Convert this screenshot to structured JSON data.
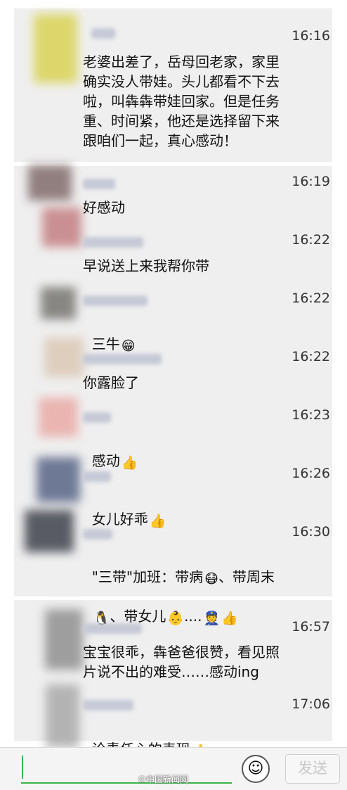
{
  "messages": [
    {
      "time": "16:16",
      "text": "老婆出差了，岳母回老家，家里\n确实没人带娃。头儿都看不下去\n啦，叫犇犇带娃回家。但是任务\n重、时间紧，他还是选择留下来\n跟咱们一起，真心感动！"
    },
    {
      "time": "16:19",
      "text": "好感动"
    },
    {
      "time": "16:22",
      "text": "早说送上来我帮你带"
    },
    {
      "time": "16:22",
      "text": "三牛",
      "emoji": "😁"
    },
    {
      "time": "16:22",
      "text": "你露脸了"
    },
    {
      "time": "16:23",
      "text": "感动",
      "emoji": "👍"
    },
    {
      "time": "16:26",
      "text": "女儿好乖",
      "emoji": "👍"
    },
    {
      "time": "16:30",
      "text_line1": "\"三带\"加班：带病",
      "emoji1": "😷",
      "text_line1b": "、带周末",
      "emoji2": "🐧",
      "text_line2": "、带女儿",
      "emoji3": "👶",
      "text_line2b": "....",
      "emoji4": "👮",
      "emoji5": "👍"
    },
    {
      "time": "16:57",
      "text": "宝宝很乖，犇爸爸很赞，看见照\n片说不出的难受……感动ing"
    },
    {
      "time": "17:06",
      "text": "论责任心的表现",
      "emoji": "👍"
    }
  ],
  "composer": {
    "emoji_icon": "smiley-icon",
    "send_label": "发送"
  },
  "watermark": "©中国新闻网"
}
